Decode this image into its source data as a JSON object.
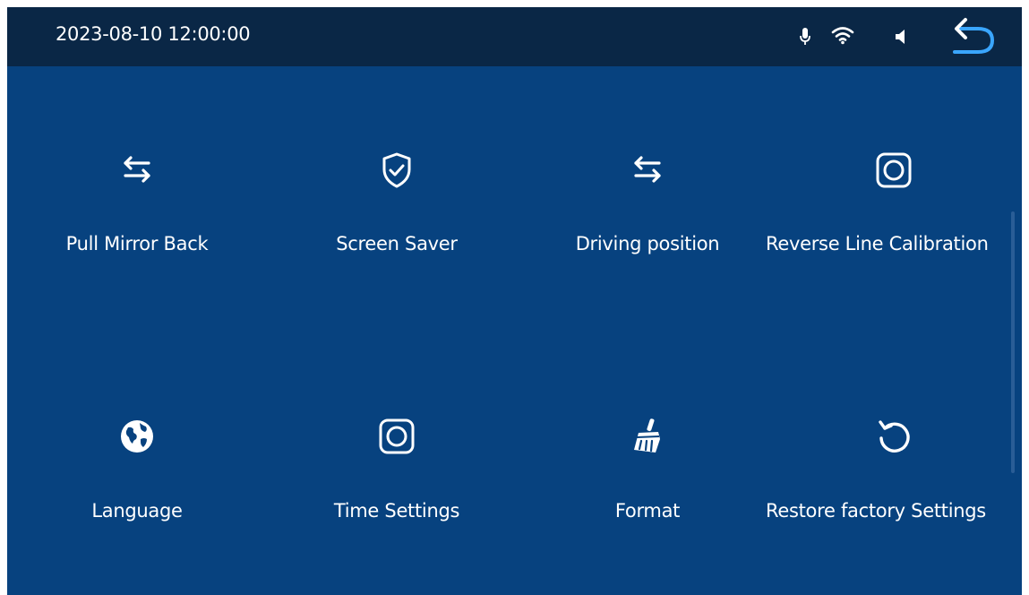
{
  "status_bar": {
    "datetime": "2023-08-10 12:00:00",
    "icons": [
      "microphone-icon",
      "wifi-icon",
      "speaker-icon",
      "back-arrow-icon"
    ]
  },
  "settings": {
    "items": [
      {
        "label": "Pull Mirror Back",
        "icon": "swap-arrows-icon"
      },
      {
        "label": "Screen Saver",
        "icon": "shield-check-icon"
      },
      {
        "label": "Driving position",
        "icon": "swap-arrows-icon"
      },
      {
        "label": "Reverse Line Calibration",
        "icon": "camera-frame-icon"
      },
      {
        "label": "Language",
        "icon": "globe-icon"
      },
      {
        "label": "Time Settings",
        "icon": "camera-frame-icon"
      },
      {
        "label": "Format",
        "icon": "broom-icon"
      },
      {
        "label": "Restore factory Settings",
        "icon": "restore-icon"
      }
    ]
  },
  "colors": {
    "background": "#07427f",
    "status_bar": "#0a2746",
    "text": "#ffffff",
    "accent": "#3aa6ff"
  }
}
